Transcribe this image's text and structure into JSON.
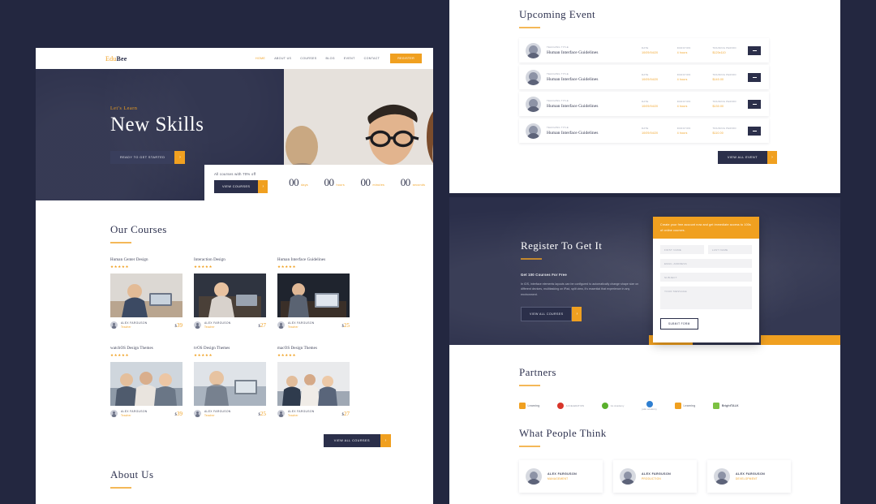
{
  "theme": {
    "navy": "#2b2f4a",
    "orange": "#f0a020",
    "page_bg": "#232740",
    "white": "#ffffff"
  },
  "left_page": {
    "navbar": {
      "logo_part1": "Edu",
      "logo_part2": "Bee",
      "links": [
        "HOME",
        "ABOUT US",
        "COURSES",
        "BLOG",
        "EVENT",
        "CONTACT"
      ],
      "cta": "REGISTER"
    },
    "hero": {
      "kicker": "Let's Learn",
      "title": "New Skills",
      "cta": "READY TO GET STARTED",
      "cta_arrow": "›"
    },
    "countdown": {
      "note": "All courses with 70% off",
      "button": "VIEW COURSES",
      "button_arrow": "›",
      "units": [
        {
          "value": "00",
          "label": "days"
        },
        {
          "value": "00",
          "label": "hours"
        },
        {
          "value": "00",
          "label": "minutes"
        },
        {
          "value": "00",
          "label": "seconds"
        }
      ]
    },
    "courses": {
      "heading": "Our Courses",
      "view_all": "VIEW ALL COURSES",
      "view_all_arrow": "›",
      "items": [
        {
          "title": "Human Center Design",
          "stars": "★★★★★",
          "author": "ALEX FARGUSON",
          "role": "Teacher",
          "currency": "$",
          "price": "39"
        },
        {
          "title": "Interaction Design",
          "stars": "★★★★★",
          "author": "ALEX FARGUSON",
          "role": "Teacher",
          "currency": "$",
          "price": "27"
        },
        {
          "title": "Human Interface Guidelines",
          "stars": "★★★★★",
          "author": "ALEX FARGUSON",
          "role": "Teacher",
          "currency": "$",
          "price": "25"
        },
        {
          "title": "watchOS Design Themes",
          "stars": "★★★★★",
          "author": "ALEX FARGUSON",
          "role": "Teacher",
          "currency": "$",
          "price": "39"
        },
        {
          "title": "tvOS Design Themes",
          "stars": "★★★★★",
          "author": "ALEX FARGUSON",
          "role": "Teacher",
          "currency": "$",
          "price": "25"
        },
        {
          "title": "macOS Design Themes",
          "stars": "★★★★★",
          "author": "ALEX FARGUSON",
          "role": "Teacher",
          "currency": "$",
          "price": "27"
        }
      ]
    },
    "about": {
      "heading": "About Us"
    }
  },
  "right_page": {
    "event": {
      "heading": "Upcoming Event",
      "labels": {
        "title": "TEACHING TITLE",
        "date": "DATE",
        "duration": "DURATION",
        "period": "TRAINING PERIOD"
      },
      "view_all": "VIEW ALL EVENT",
      "view_all_arrow": "›",
      "rows": [
        {
          "title": "Human Interface Guidelines",
          "date": "10/09/04/20",
          "duration": "4 hours",
          "period": "$120x110",
          "action": "–"
        },
        {
          "title": "Human Interface Guidelines",
          "date": "10/09/04/20",
          "duration": "4 hours",
          "period": "$140.00",
          "action": "–"
        },
        {
          "title": "Human Interface Guidelines",
          "date": "10/09/04/20",
          "duration": "4 hours",
          "period": "$130.00",
          "action": "–"
        },
        {
          "title": "Human Interface Guidelines",
          "date": "10/09/04/20",
          "duration": "4 hours",
          "period": "$110.00",
          "action": "–"
        }
      ]
    },
    "register": {
      "title": "Register To Get It",
      "subtitle": "Get 100 Courses For Free",
      "body": "In iOS, interface elements layouts can be configured to automatically change shape size on different devices, multitasking on iPad, split view, it's essential that experience in any environment.",
      "button": "VIEW ALL COURSES",
      "button_arrow": "›",
      "form": {
        "banner": "Create your free account now and get immediate access to 100s of online courses.",
        "first_name": "FIRST NAME",
        "last_name": "LAST NAME",
        "email": "EMAIL ADDRESS",
        "subject": "SUBJECT",
        "message": "YOUR MESSAGE",
        "submit": "SUBMIT FORM"
      }
    },
    "partners": {
      "heading": "Partners",
      "logos": [
        {
          "name": "Learning",
          "sub": "",
          "color": "#f0a020",
          "shape": "square"
        },
        {
          "name": "ACCELERATION",
          "sub": "",
          "color": "#d8352a",
          "shape": "round"
        },
        {
          "name": "GL Academy",
          "sub": "",
          "color": "#5ab02c",
          "shape": "round"
        },
        {
          "name": "",
          "sub": "jade academy",
          "color": "#2f7fd1",
          "shape": "round"
        },
        {
          "name": "Learning",
          "sub": "",
          "color": "#f0a020",
          "shape": "square"
        },
        {
          "name": "BrightTALK",
          "sub": "",
          "color": "#7cc142",
          "shape": "square"
        }
      ]
    },
    "testimonials": {
      "heading": "What People Think",
      "cards": [
        {
          "name": "ALEX FARGUSON",
          "role": "MANAGEMENT"
        },
        {
          "name": "ALEX FARGUSON",
          "role": "PRODUCTION"
        },
        {
          "name": "ALEX FARGUSON",
          "role": "DEVELOPMENT"
        }
      ]
    }
  }
}
